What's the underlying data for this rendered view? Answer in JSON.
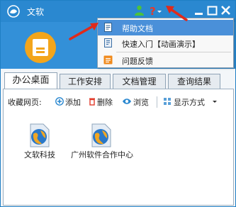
{
  "window": {
    "title": "文软"
  },
  "help_menu": {
    "items": [
      {
        "label": "帮助文档",
        "icon": "help-doc-icon"
      },
      {
        "label": "快速入门【动画演示】",
        "icon": "quick-start-icon"
      },
      {
        "label": "问题反馈",
        "icon": "feedback-icon"
      }
    ]
  },
  "tabs": [
    {
      "label": "办公桌面",
      "active": true
    },
    {
      "label": "工作安排",
      "active": false
    },
    {
      "label": "文档管理",
      "active": false
    },
    {
      "label": "查询结果",
      "active": false
    }
  ],
  "toolbar": {
    "label": "收藏网页:",
    "add": "添加",
    "delete": "删除",
    "browse": "浏览",
    "view_mode": "显示方式"
  },
  "favorites": [
    {
      "label": "文软科技"
    },
    {
      "label": "广州软件合作中心"
    }
  ],
  "colors": {
    "titlebar": "#2a88d0",
    "header": "#3390d8",
    "accent": "#f3a51b",
    "highlight": "#4a90d9",
    "annotation_arrow": "#e02a1a"
  }
}
